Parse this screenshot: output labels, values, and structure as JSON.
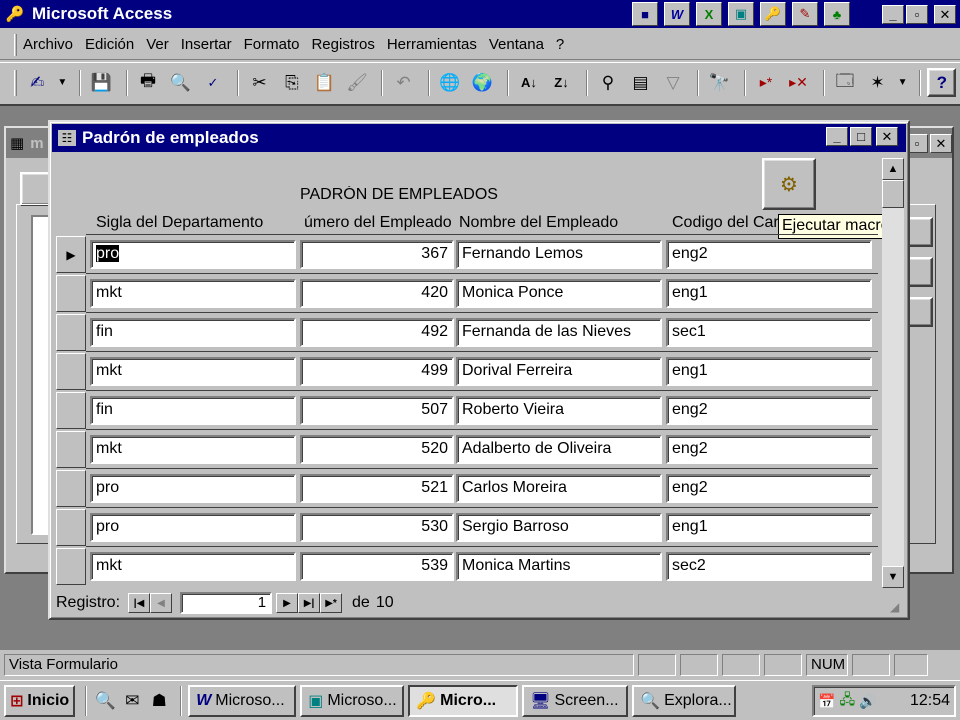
{
  "app": {
    "title": "Microsoft Access"
  },
  "menu": [
    "Archivo",
    "Edición",
    "Ver",
    "Insertar",
    "Formato",
    "Registros",
    "Herramientas",
    "Ventana",
    "?"
  ],
  "db_window": {
    "title_partial": "m"
  },
  "form": {
    "title": "Padrón de empleados",
    "heading": "PADRÓN DE EMPLEADOS",
    "columns": [
      "Sigla del Departamento",
      "úmero del Empleado",
      "Nombre del Empleado",
      "Codigo del Carg"
    ],
    "tooltip": "Ejecutar macro",
    "rows": [
      {
        "dept": "pro",
        "num": "367",
        "name": "Fernando Lemos",
        "code": "eng2"
      },
      {
        "dept": "mkt",
        "num": "420",
        "name": "Monica Ponce",
        "code": "eng1"
      },
      {
        "dept": "fin",
        "num": "492",
        "name": "Fernanda de las Nieves",
        "code": "sec1"
      },
      {
        "dept": "mkt",
        "num": "499",
        "name": "Dorival Ferreira",
        "code": "eng1"
      },
      {
        "dept": "fin",
        "num": "507",
        "name": "Roberto Vieira",
        "code": "eng2"
      },
      {
        "dept": "mkt",
        "num": "520",
        "name": "Adalberto de Oliveira",
        "code": "eng2"
      },
      {
        "dept": "pro",
        "num": "521",
        "name": "Carlos Moreira",
        "code": "eng2"
      },
      {
        "dept": "pro",
        "num": "530",
        "name": "Sergio Barroso",
        "code": "eng1"
      },
      {
        "dept": "mkt",
        "num": "539",
        "name": "Monica Martins",
        "code": "sec2"
      }
    ],
    "nav": {
      "label": "Registro:",
      "current": "1",
      "of_label": "de",
      "total": "10"
    }
  },
  "status": {
    "text": "Vista Formulario",
    "num": "NUM"
  },
  "taskbar": {
    "start": "Inicio",
    "tasks": [
      "Microso...",
      "Microso...",
      "Micro...",
      "Screen...",
      "Explora..."
    ],
    "clock": "12:54"
  }
}
